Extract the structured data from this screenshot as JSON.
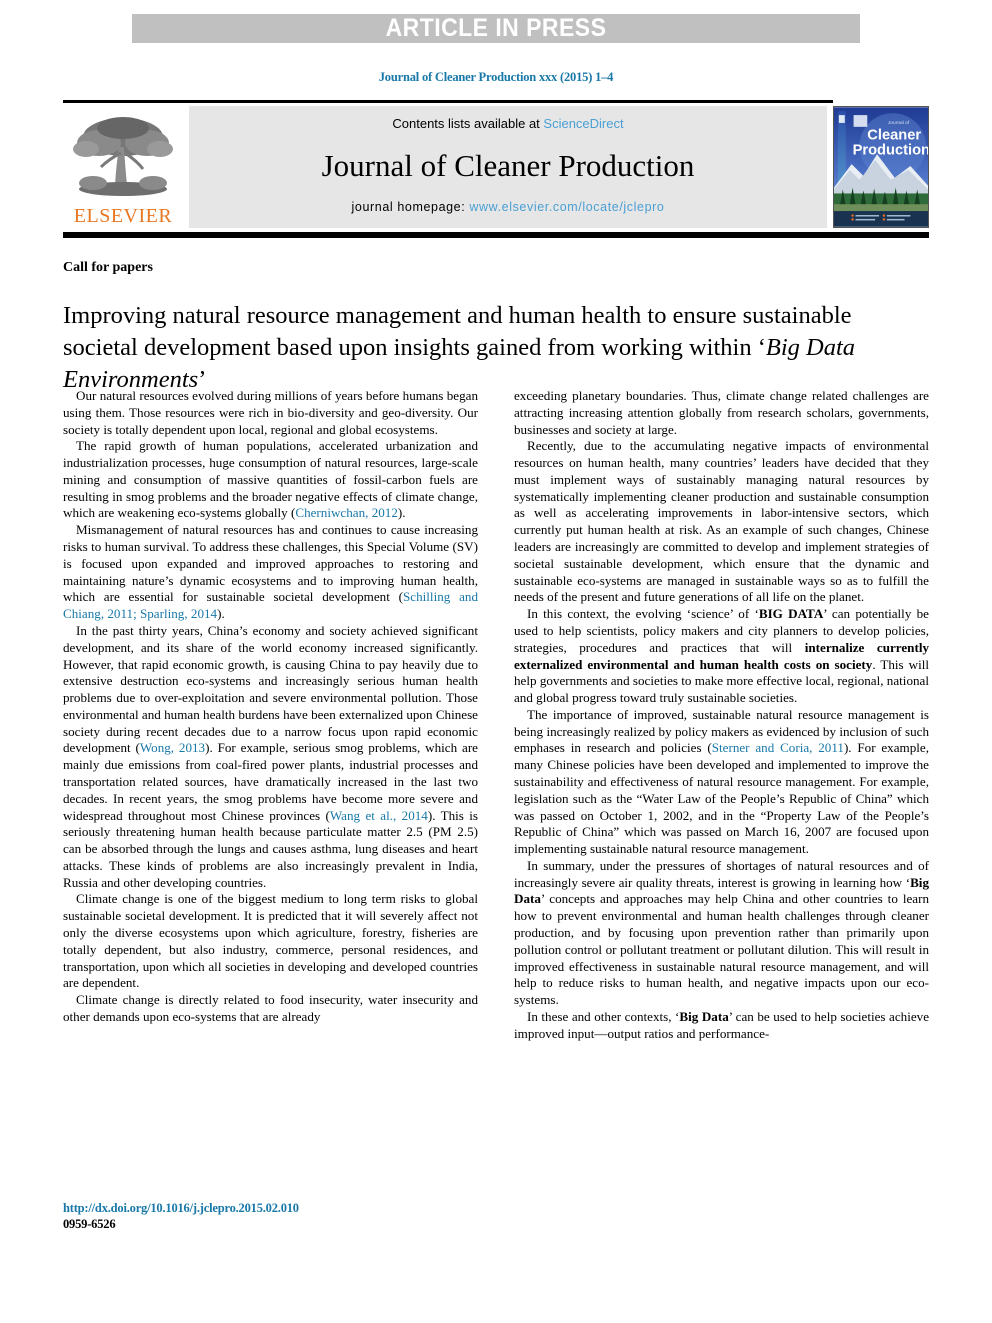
{
  "banner": {
    "text": "ARTICLE IN PRESS"
  },
  "citation": {
    "line": "Journal of Cleaner Production xxx (2015) 1–4"
  },
  "masthead": {
    "contents_prefix": "Contents lists available at ",
    "sciencedirect": "ScienceDirect",
    "journal_title": "Journal of Cleaner Production",
    "homepage_label": "journal homepage: ",
    "homepage_url": "www.elsevier.com/locate/jclepro",
    "publisher_name": "ELSEVIER",
    "cover_title_line1": "Journal of",
    "cover_title_line2": "Cleaner",
    "cover_title_line3": "Production"
  },
  "article": {
    "section_label": "Call for papers",
    "title_plain_1": "Improving natural resource management and human health to ensure sustainable societal development based upon insights gained from working within ‘",
    "title_italic": "Big Data Environments",
    "title_plain_2": "’"
  },
  "body": {
    "left_column": [
      {
        "runs": [
          {
            "t": "Our natural resources evolved during millions of years before humans began using them. Those resources were rich in bio-diversity and geo-diversity. Our society is totally dependent upon local, regional and global ecosystems."
          }
        ]
      },
      {
        "runs": [
          {
            "t": "The rapid growth of human populations, accelerated urbanization and industrialization processes, huge consumption of natural resources, large-scale mining and consumption of massive quantities of fossil-carbon fuels are resulting in smog problems and the broader negative effects of climate change, which are weakening eco-systems globally ("
          },
          {
            "t": "Cherniwchan, 2012",
            "c": "cit"
          },
          {
            "t": ")."
          }
        ]
      },
      {
        "runs": [
          {
            "t": "Mismanagement of natural resources has and continues to cause increasing risks to human survival. To address these challenges, this Special Volume (SV) is focused upon expanded and improved approaches to restoring and maintaining nature’s dynamic ecosystems and to improving human health, which are essential for sustainable societal development ("
          },
          {
            "t": "Schilling and Chiang, 2011; Sparling, 2014",
            "c": "cit"
          },
          {
            "t": ")."
          }
        ]
      },
      {
        "runs": [
          {
            "t": "In the past thirty years, China’s economy and society achieved significant development, and its share of the world economy increased significantly. However, that rapid economic growth, is causing China to pay heavily due to extensive destruction eco-systems and increasingly serious human health problems due to over-exploitation and severe environmental pollution. Those environmental and human health burdens have been externalized upon Chinese society during recent decades due to a narrow focus upon rapid economic development ("
          },
          {
            "t": "Wong, 2013",
            "c": "cit"
          },
          {
            "t": "). For example, serious smog problems, which are mainly due emissions from coal-fired power plants, industrial processes and transportation related sources, have dramatically increased in the last two decades. In recent years, the smog problems have become more severe and widespread throughout most Chinese provinces ("
          },
          {
            "t": "Wang et al., 2014",
            "c": "cit"
          },
          {
            "t": "). This is seriously threatening human health because particulate matter 2.5 (PM 2.5) can be absorbed through the lungs and causes asthma, lung diseases and heart attacks. These kinds of problems are also increasingly prevalent in India, Russia and other developing countries."
          }
        ]
      },
      {
        "runs": [
          {
            "t": "Climate change is one of the biggest medium to long term risks to global sustainable societal development. It is predicted that it will severely affect not only the diverse ecosystems upon which agriculture, forestry, fisheries are totally dependent, but also industry, commerce, personal residences, and transportation, upon which all societies in developing and developed countries are dependent."
          }
        ]
      },
      {
        "runs": [
          {
            "t": "Climate change is directly related to food insecurity, water insecurity and other demands upon eco-systems that are already"
          }
        ]
      }
    ],
    "right_column": [
      {
        "no_indent": true,
        "runs": [
          {
            "t": "exceeding planetary boundaries. Thus, climate change related challenges are attracting increasing attention globally from research scholars, governments, businesses and society at large."
          }
        ]
      },
      {
        "runs": [
          {
            "t": "Recently, due to the accumulating negative impacts of environmental resources on human health, many countries’ leaders have decided that they must implement ways of sustainably managing natural resources by systematically implementing cleaner production and sustainable consumption as well as accelerating improvements in labor-intensive sectors, which currently put human health at risk. As an example of such changes, Chinese leaders are increasingly are committed to develop and implement strategies of societal sustainable development, which ensure that the dynamic and sustainable eco-systems are managed in sustainable ways so as to fulfill the needs of the present and future generations of all life on the planet."
          }
        ]
      },
      {
        "runs": [
          {
            "t": "In this context, the evolving ‘science’ of ‘"
          },
          {
            "t": "BIG DATA",
            "c": "bold"
          },
          {
            "t": "’ can potentially be used to help scientists, policy makers and city planners to develop policies, strategies, procedures and practices that will "
          },
          {
            "t": "internalize currently externalized environmental and human health costs on society",
            "c": "bold"
          },
          {
            "t": ". This will help governments and societies to make more effective local, regional, national and global progress toward truly sustainable societies."
          }
        ]
      },
      {
        "runs": [
          {
            "t": "The importance of improved, sustainable natural resource management is being increasingly realized by policy makers as evidenced by inclusion of such emphases in research and policies ("
          },
          {
            "t": "Sterner and Coria, 2011",
            "c": "cit"
          },
          {
            "t": "). For example, many Chinese policies have been developed and implemented to improve the sustainability and effectiveness of natural resource management. For example, legislation such as the “Water Law of the People’s Republic of China” which was passed on October 1, 2002, and in the “Property Law of the People’s Republic of China” which was passed on March 16, 2007 are focused upon implementing sustainable natural resource management."
          }
        ]
      },
      {
        "runs": [
          {
            "t": "In summary, under the pressures of shortages of natural resources and of increasingly severe air quality threats, interest is growing in learning how ‘"
          },
          {
            "t": "Big Data",
            "c": "bold"
          },
          {
            "t": "’ concepts and approaches may help China and other countries to learn how to prevent environmental and human health challenges through cleaner production, and by focusing upon prevention rather than primarily upon pollution control or pollutant treatment or pollutant dilution. This will result in improved effectiveness in sustainable natural resource management, and will help to reduce risks to human health, and negative impacts upon our eco-systems."
          }
        ]
      },
      {
        "runs": [
          {
            "t": "In these and other contexts, ‘"
          },
          {
            "t": "Big Data",
            "c": "bold"
          },
          {
            "t": "’ can be used to help societies achieve improved input—output ratios and performance-"
          }
        ]
      }
    ]
  },
  "footer": {
    "doi": "http://dx.doi.org/10.1016/j.jclepro.2015.02.010",
    "issn": "0959-6526"
  },
  "colors": {
    "link_blue": "#1878a8",
    "sciencedirect_blue": "#4a9fd4",
    "elsevier_orange": "#e87722",
    "banner_grey": "#c0c0c0",
    "panel_grey": "#e6e6e6"
  }
}
